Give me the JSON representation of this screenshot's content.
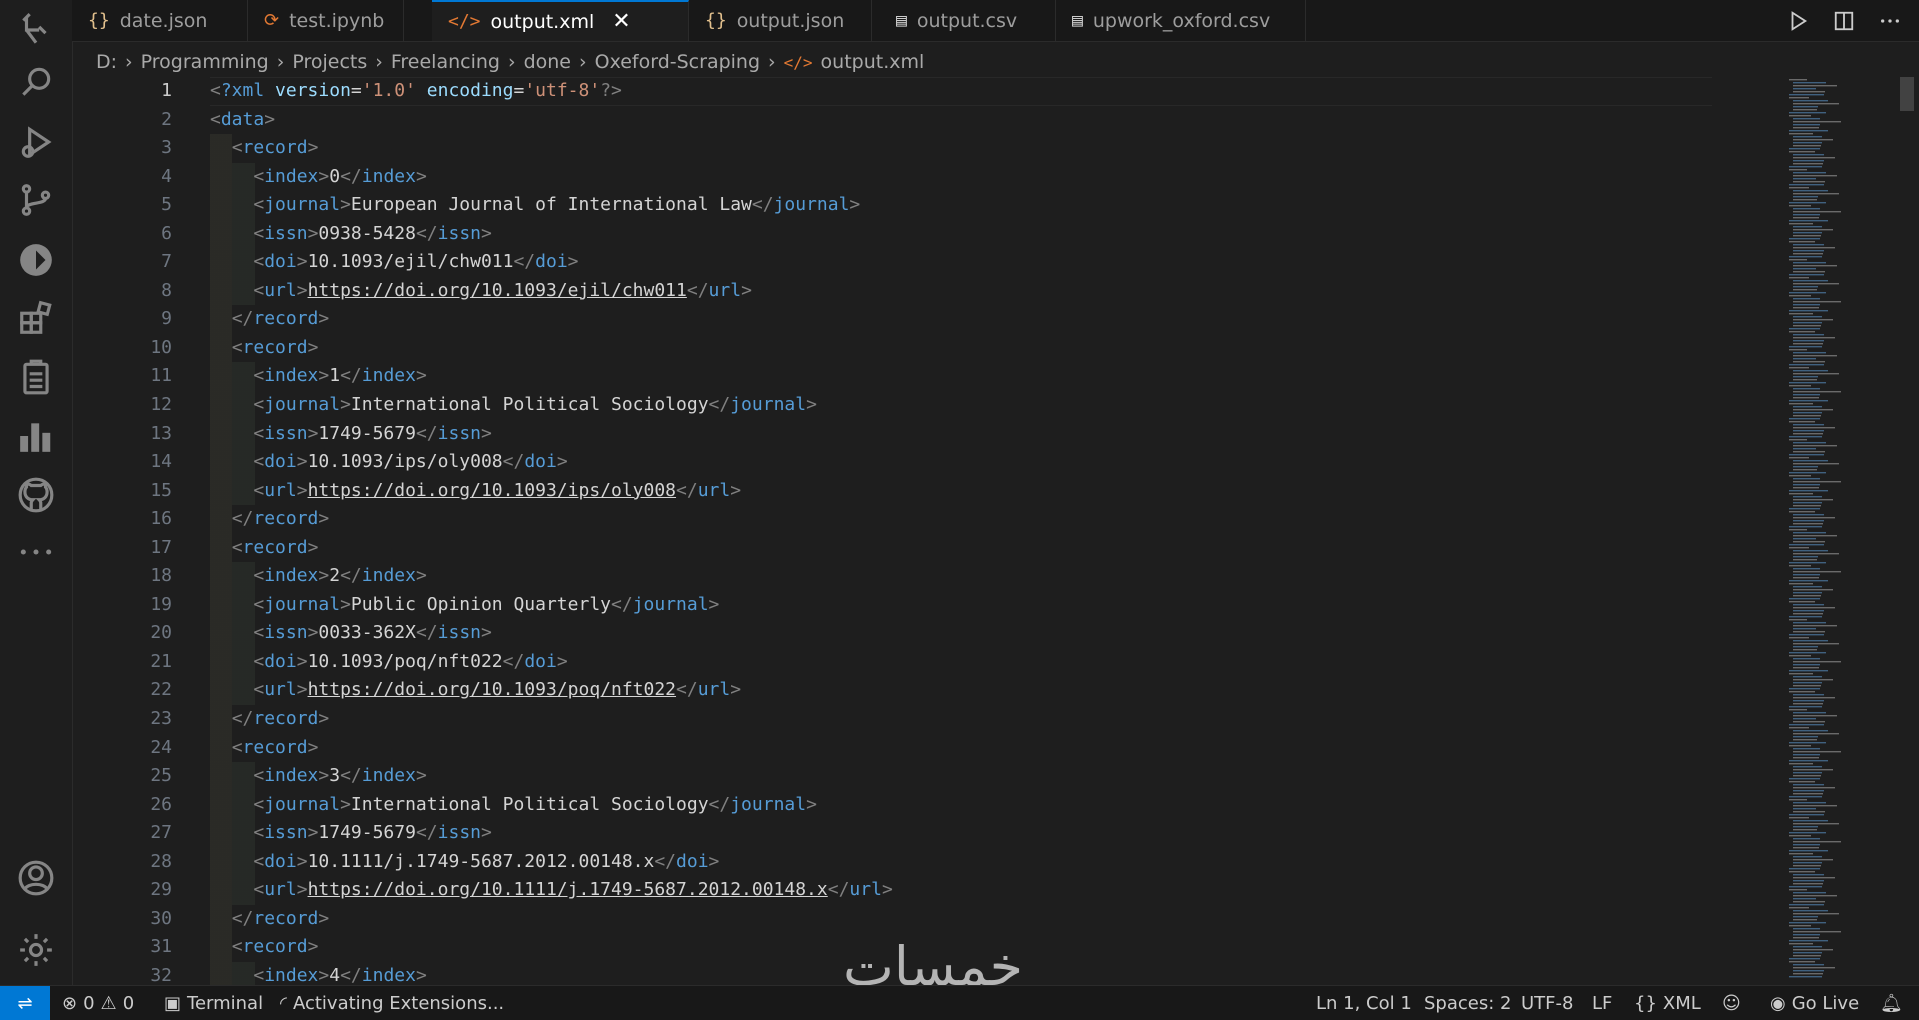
{
  "tabs": [
    {
      "icon": "{}",
      "label": "date.json",
      "active": false
    },
    {
      "icon": "⟳",
      "label": "test.ipynb",
      "active": false
    },
    {
      "icon": "</>",
      "label": "output.xml",
      "active": true
    },
    {
      "icon": "{}",
      "label": "output.json",
      "active": false
    },
    {
      "icon": "▤",
      "label": "output.csv",
      "active": false
    },
    {
      "icon": "▤",
      "label": "upwork_oxford.csv",
      "active": false
    }
  ],
  "breadcrumb": [
    "D:",
    "Programming",
    "Projects",
    "Freelancing",
    "done",
    "Oxeford-Scraping",
    "output.xml"
  ],
  "editor": {
    "current_line": 1,
    "line_numbers": [
      "1",
      "2",
      "3",
      "4",
      "5",
      "6",
      "7",
      "8",
      "9",
      "10",
      "11",
      "12",
      "13",
      "14",
      "15",
      "16",
      "17",
      "18",
      "19",
      "20",
      "21",
      "22",
      "23",
      "24",
      "25",
      "26",
      "27",
      "28",
      "29",
      "30",
      "31",
      "32"
    ],
    "xml_decl": {
      "tag": "?xml",
      "attr1": "version",
      "val1": "'1.0'",
      "attr2": "encoding",
      "val2": "'utf-8'"
    },
    "root_tag": "data",
    "record_tag": "record",
    "field_tags": {
      "index": "index",
      "journal": "journal",
      "issn": "issn",
      "doi": "doi",
      "url": "url"
    },
    "records": [
      {
        "index": "0",
        "journal": "European Journal of International Law",
        "issn": "0938-5428",
        "doi": "10.1093/ejil/chw011",
        "url": "https://doi.org/10.1093/ejil/chw011"
      },
      {
        "index": "1",
        "journal": "International Political Sociology",
        "issn": "1749-5679",
        "doi": "10.1093/ips/oly008",
        "url": "https://doi.org/10.1093/ips/oly008"
      },
      {
        "index": "2",
        "journal": "Public Opinion Quarterly",
        "issn": "0033-362X",
        "doi": "10.1093/poq/nft022",
        "url": "https://doi.org/10.1093/poq/nft022"
      },
      {
        "index": "3",
        "journal": "International Political Sociology",
        "issn": "1749-5679",
        "doi": "10.1111/j.1749-5687.2012.00148.x",
        "url": "https://doi.org/10.1111/j.1749-5687.2012.00148.x"
      },
      {
        "index": "4"
      }
    ]
  },
  "statusbar": {
    "errors": "0",
    "warnings": "0",
    "terminal": "Terminal",
    "activity": "Activating Extensions...",
    "position": "Ln 1, Col 1",
    "spaces": "Spaces: 2",
    "encoding": "UTF-8",
    "eol": "LF",
    "language": "XML",
    "golive": "Go Live"
  },
  "watermark": "خمسات",
  "colors": {
    "tag": "#569cd6",
    "attr": "#9cdcfe",
    "string": "#ce9178",
    "accent": "#0078d4"
  }
}
